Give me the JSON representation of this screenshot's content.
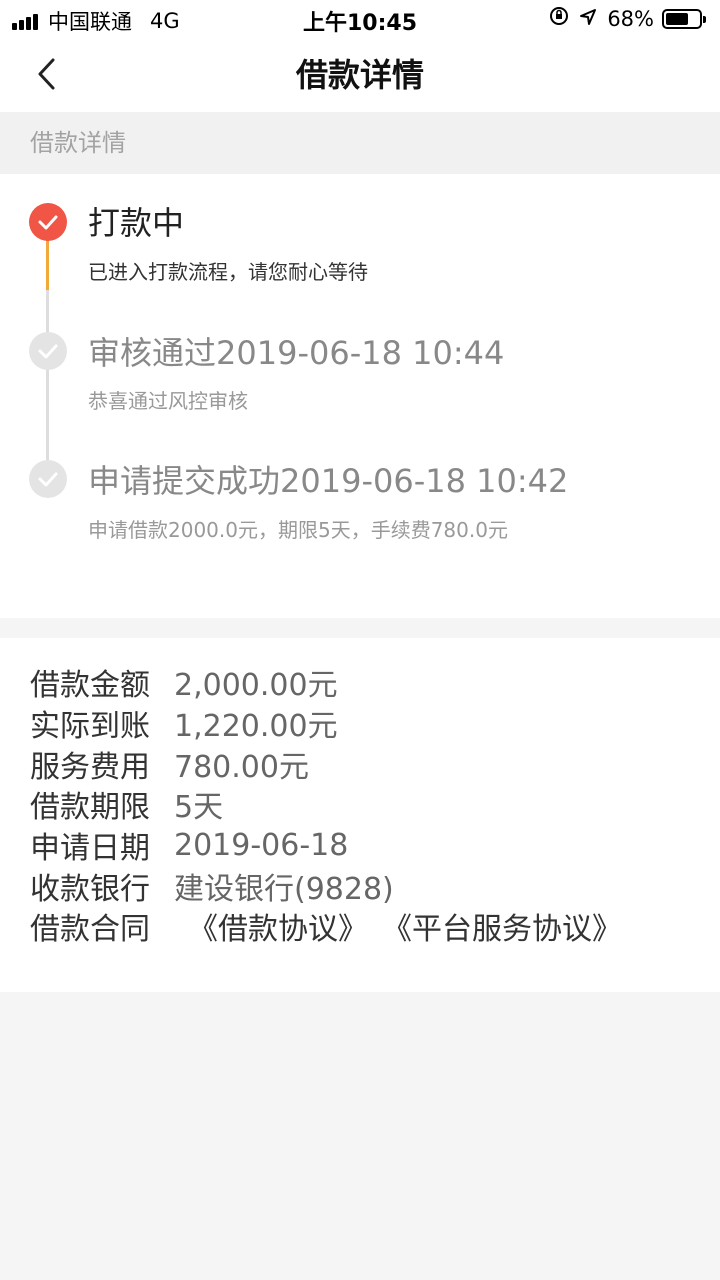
{
  "status_bar": {
    "carrier": "中国联通",
    "network": "4G",
    "time": "上午10:45",
    "battery_percent": "68%",
    "battery_level": 0.68
  },
  "nav": {
    "title": "借款详情",
    "back_icon": "chevron-left-icon"
  },
  "section_header": "借款详情",
  "timeline": [
    {
      "title": "打款中",
      "subtitle": "已进入打款流程，请您耐心等待",
      "active": true
    },
    {
      "title": "审核通过2019-06-18 10:44",
      "subtitle": "恭喜通过风控审核",
      "active": false
    },
    {
      "title": "申请提交成功2019-06-18 10:42",
      "subtitle": "申请借款2000.0元，期限5天，手续费780.0元",
      "active": false
    }
  ],
  "details": [
    {
      "label": "借款金额",
      "value": "2,000.00元"
    },
    {
      "label": "实际到账",
      "value": "1,220.00元"
    },
    {
      "label": "服务费用",
      "value": "780.00元"
    },
    {
      "label": "借款期限",
      "value": "5天"
    },
    {
      "label": "申请日期",
      "value": "2019-06-18"
    },
    {
      "label": "收款银行",
      "value": "建设银行(9828)"
    }
  ],
  "contract": {
    "label": "借款合同",
    "links": [
      "《借款协议》",
      "《平台服务协议》"
    ]
  },
  "colors": {
    "active": "#f05545",
    "active_line": "#f3a93a",
    "inactive_dot": "#e4e4e4",
    "inactive_line": "#dddddd"
  }
}
